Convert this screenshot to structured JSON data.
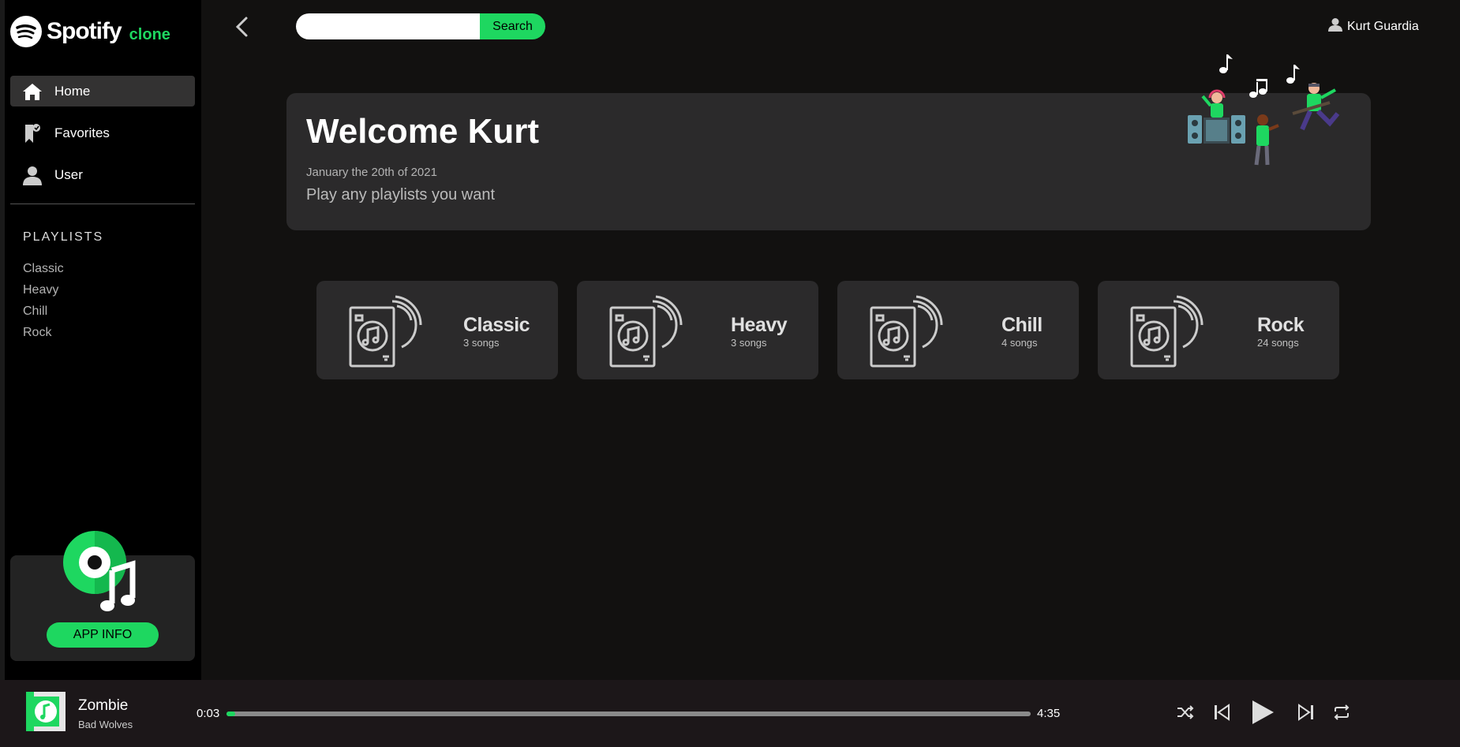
{
  "brand": {
    "name": "Spotify",
    "suffix": "clone"
  },
  "sidebar": {
    "nav": [
      {
        "label": "Home",
        "icon": "home-icon",
        "active": true
      },
      {
        "label": "Favorites",
        "icon": "bookmark-heart-icon",
        "active": false
      },
      {
        "label": "User",
        "icon": "user-icon",
        "active": false
      }
    ],
    "playlists_title": "PLAYLISTS",
    "playlists": [
      "Classic",
      "Heavy",
      "Chill",
      "Rock"
    ],
    "app_info_label": "APP INFO"
  },
  "header": {
    "search_placeholder": "",
    "search_button": "Search",
    "user_name": "Kurt Guardia"
  },
  "welcome": {
    "title": "Welcome Kurt",
    "date": "January the 20th of 2021",
    "subtitle": "Play any playlists you want"
  },
  "cards": [
    {
      "name": "Classic",
      "count": "3 songs"
    },
    {
      "name": "Heavy",
      "count": "3 songs"
    },
    {
      "name": "Chill",
      "count": "4 songs"
    },
    {
      "name": "Rock",
      "count": "24 songs"
    }
  ],
  "player": {
    "title": "Zombie",
    "artist": "Bad Wolves",
    "current_time": "0:03",
    "total_time": "4:35",
    "progress": 0.011
  },
  "colors": {
    "accent": "#1ed760",
    "sidebar": "#000000",
    "background": "#121110",
    "card": "#2b2a2b"
  }
}
